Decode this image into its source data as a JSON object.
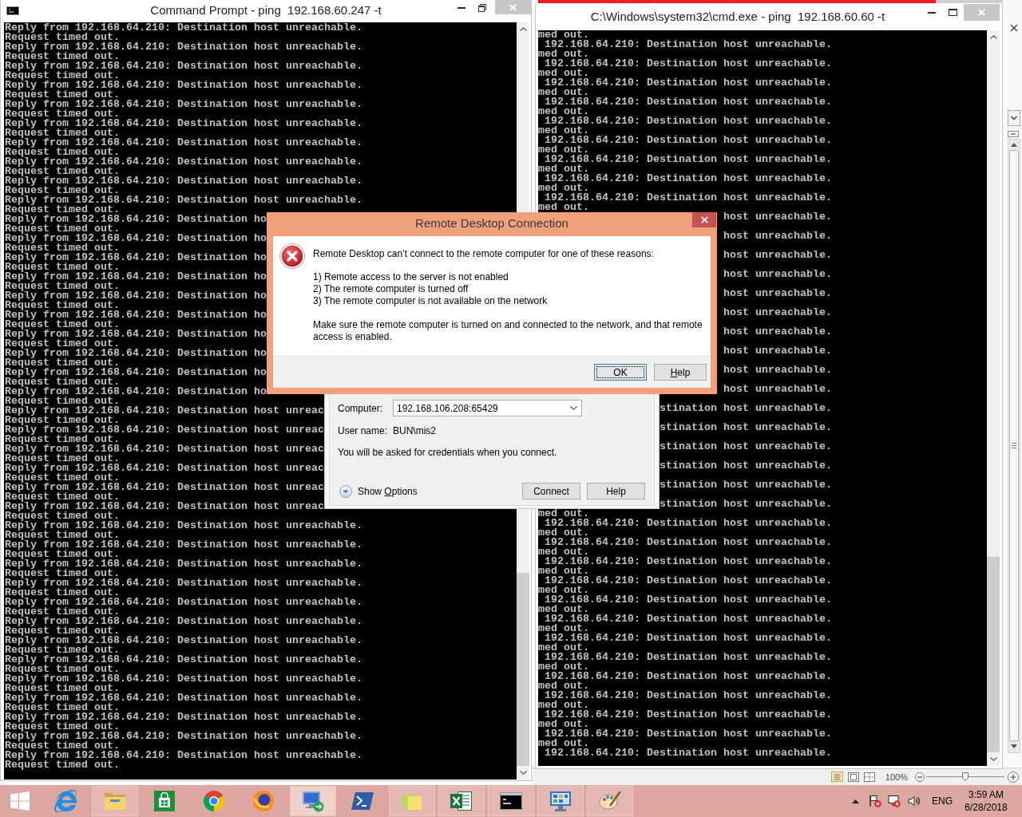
{
  "left_window": {
    "title": "Command Prompt - ping  192.168.60.247 -t",
    "lines": [
      "Reply from 192.168.64.210: Destination host unreachable.",
      "Request timed out.",
      "Reply from 192.168.64.210: Destination host unreachable.",
      "Request timed out.",
      "Reply from 192.168.64.210: Destination host unreachable.",
      "Request timed out.",
      "Reply from 192.168.64.210: Destination host unreachable.",
      "Request timed out.",
      "Reply from 192.168.64.210: Destination host unreachable.",
      "Request timed out.",
      "Reply from 192.168.64.210: Destination host unreachable.",
      "Request timed out.",
      "Reply from 192.168.64.210: Destination host unreachable.",
      "Request timed out.",
      "Reply from 192.168.64.210: Destination host unreachable.",
      "Request timed out.",
      "Reply from 192.168.64.210: Destination host unreachable.",
      "Request timed out.",
      "Reply from 192.168.64.210: Destination host unreachable.",
      "Request timed out.",
      "Reply from 192.168.64.210: Destination ho",
      "Request timed out.",
      "Reply from 192.168.64.210: Destination ho",
      "Request timed out.",
      "Reply from 192.168.64.210: Destination ho",
      "Request timed out.",
      "Reply from 192.168.64.210: Destination ho",
      "Request timed out.",
      "Reply from 192.168.64.210: Destination ho",
      "Request timed out.",
      "Reply from 192.168.64.210: Destination ho",
      "Request timed out.",
      "Reply from 192.168.64.210: Destination ho",
      "Request timed out.",
      "Reply from 192.168.64.210: Destination ho",
      "Request timed out.",
      "Reply from 192.168.64.210: Destination ho",
      "Request timed out.",
      "Reply from 192.168.64.210: Destination ho",
      "Request timed out.",
      "Reply from 192.168.64.210: Destination host unreac",
      "Request timed out.",
      "Reply from 192.168.64.210: Destination host unreac",
      "Request timed out.",
      "Reply from 192.168.64.210: Destination host unreac",
      "Request timed out.",
      "Reply from 192.168.64.210: Destination host unreac",
      "Request timed out.",
      "Reply from 192.168.64.210: Destination host unreac",
      "Request timed out.",
      "Reply from 192.168.64.210: Destination host unreac",
      "Request timed out.",
      "Reply from 192.168.64.210: Destination host unreachable.",
      "Request timed out.",
      "Reply from 192.168.64.210: Destination host unreachable.",
      "Request timed out.",
      "Reply from 192.168.64.210: Destination host unreachable.",
      "Request timed out.",
      "Reply from 192.168.64.210: Destination host unreachable.",
      "Request timed out.",
      "Reply from 192.168.64.210: Destination host unreachable.",
      "Request timed out.",
      "Reply from 192.168.64.210: Destination host unreachable.",
      "Request timed out.",
      "Reply from 192.168.64.210: Destination host unreachable.",
      "Request timed out.",
      "Reply from 192.168.64.210: Destination host unreachable.",
      "Request timed out.",
      "Reply from 192.168.64.210: Destination host unreachable.",
      "Request timed out.",
      "Reply from 192.168.64.210: Destination host unreachable.",
      "Request timed out.",
      "Reply from 192.168.64.210: Destination host unreachable.",
      "Request timed out.",
      "Reply from 192.168.64.210: Destination host unreachable.",
      "Request timed out.",
      "Reply from 192.168.64.210: Destination host unreachable.",
      "Request timed out."
    ]
  },
  "right_window": {
    "title": "C:\\Windows\\system32\\cmd.exe - ping  192.168.60.60 -t",
    "lines": [
      {
        "text": "med out.",
        "kind": "line"
      },
      {
        "text": " 192.168.64.210: Destination host unreachable.",
        "kind": "line"
      },
      {
        "text": "med out.",
        "kind": "line"
      },
      {
        "text": " 192.168.64.210: Destination host unreachable.",
        "kind": "line"
      },
      {
        "text": "med out.",
        "kind": "line"
      },
      {
        "text": " 192.168.64.210: Destination host unreachable.",
        "kind": "line"
      },
      {
        "text": "med out.",
        "kind": "line"
      },
      {
        "text": " 192.168.64.210: Destination host unreachable.",
        "kind": "line"
      },
      {
        "text": "med out.",
        "kind": "line"
      },
      {
        "text": " 192.168.64.210: Destination host unreachable.",
        "kind": "line"
      },
      {
        "text": "med out.",
        "kind": "line"
      },
      {
        "text": " 192.168.64.210: Destination host unreachable.",
        "kind": "line"
      },
      {
        "text": "med out.",
        "kind": "line"
      },
      {
        "text": " 192.168.64.210: Destination host unreachable.",
        "kind": "line"
      },
      {
        "text": "med out.",
        "kind": "line"
      },
      {
        "text": " 192.168.64.210: Destination host unreachable.",
        "kind": "line"
      },
      {
        "text": "med out.",
        "kind": "line"
      },
      {
        "text": " 192.168.64.210: Destination host unreachable.",
        "kind": "line"
      },
      {
        "text": "med out.",
        "kind": "line"
      },
      {
        "text": "host unreachable.",
        "kind": "tail"
      },
      {
        "kind": "covered"
      },
      {
        "text": "host unreachable.",
        "kind": "tail"
      },
      {
        "kind": "covered"
      },
      {
        "text": "host unreachable.",
        "kind": "tail"
      },
      {
        "kind": "covered"
      },
      {
        "text": "host unreachable.",
        "kind": "tail"
      },
      {
        "kind": "covered"
      },
      {
        "text": "host unreachable.",
        "kind": "tail"
      },
      {
        "kind": "covered"
      },
      {
        "text": "host unreachable.",
        "kind": "tail"
      },
      {
        "kind": "covered"
      },
      {
        "text": "host unreachable.",
        "kind": "tail"
      },
      {
        "kind": "covered"
      },
      {
        "text": "host unreachable.",
        "kind": "tail"
      },
      {
        "kind": "covered"
      },
      {
        "text": "host unreachable.",
        "kind": "tail"
      },
      {
        "kind": "covered"
      },
      {
        "text": "host unreachable.",
        "kind": "tail"
      },
      {
        "kind": "covered"
      },
      {
        "text": "stination host unreachable.",
        "kind": "tail"
      },
      {
        "kind": "covered"
      },
      {
        "text": "stination host unreachable.",
        "kind": "tail"
      },
      {
        "kind": "covered"
      },
      {
        "text": "stination host unreachable.",
        "kind": "tail"
      },
      {
        "kind": "covered"
      },
      {
        "text": "stination host unreachable.",
        "kind": "tail"
      },
      {
        "kind": "covered"
      },
      {
        "text": "stination host unreachable.",
        "kind": "tail"
      },
      {
        "kind": "covered"
      },
      {
        "text": "stination host unreachable.",
        "kind": "tail"
      },
      {
        "text": "med out.",
        "kind": "line"
      },
      {
        "text": " 192.168.64.210: Destination host unreachable.",
        "kind": "line"
      },
      {
        "text": "med out.",
        "kind": "line"
      },
      {
        "text": " 192.168.64.210: Destination host unreachable.",
        "kind": "line"
      },
      {
        "text": "med out.",
        "kind": "line"
      },
      {
        "text": " 192.168.64.210: Destination host unreachable.",
        "kind": "line"
      },
      {
        "text": "med out.",
        "kind": "line"
      },
      {
        "text": " 192.168.64.210: Destination host unreachable.",
        "kind": "line"
      },
      {
        "text": "med out.",
        "kind": "line"
      },
      {
        "text": " 192.168.64.210: Destination host unreachable.",
        "kind": "line"
      },
      {
        "text": "med out.",
        "kind": "line"
      },
      {
        "text": " 192.168.64.210: Destination host unreachable.",
        "kind": "line"
      },
      {
        "text": "med out.",
        "kind": "line"
      },
      {
        "text": " 192.168.64.210: Destination host unreachable.",
        "kind": "line"
      },
      {
        "text": "med out.",
        "kind": "line"
      },
      {
        "text": " 192.168.64.210: Destination host unreachable.",
        "kind": "line"
      },
      {
        "text": "med out.",
        "kind": "line"
      },
      {
        "text": " 192.168.64.210: Destination host unreachable.",
        "kind": "line"
      },
      {
        "text": "med out.",
        "kind": "line"
      },
      {
        "text": " 192.168.64.210: Destination host unreachable.",
        "kind": "line"
      },
      {
        "text": "med out.",
        "kind": "line"
      },
      {
        "text": " 192.168.64.210: Destination host unreachable.",
        "kind": "line"
      },
      {
        "text": "med out.",
        "kind": "line"
      },
      {
        "text": " 192.168.64.210: Destination host unreachable.",
        "kind": "line"
      },
      {
        "text": "med out.",
        "kind": "line"
      },
      {
        "text": " 192.168.64.210: Destination host unreachable.",
        "kind": "line"
      }
    ]
  },
  "error_dialog": {
    "title": "Remote Desktop Connection",
    "message": "Remote Desktop can’t connect to the remote computer for one of these reasons:",
    "reasons": [
      "1) Remote access to the server is not enabled",
      "2) The remote computer is turned off",
      "3) The remote computer is not available on the network"
    ],
    "advice": "Make sure the remote computer is turned on and connected to the network, and that remote access is enabled.",
    "buttons": [
      {
        "label_parts": [
          {
            "text": "OK",
            "underlined": false
          }
        ],
        "selected": true
      },
      {
        "label_parts": [
          {
            "text": "H",
            "underlined": true
          },
          {
            "text": "elp",
            "underlined": false
          }
        ],
        "selected": false
      }
    ]
  },
  "connection_window": {
    "fields": [
      {
        "label": "Computer:",
        "value": "192.168.106.208:65429",
        "kind": "combobox"
      },
      {
        "label": "User name:",
        "value": "BUN\\mis2",
        "kind": "text"
      }
    ],
    "note": "You will be asked for credentials when you connect.",
    "show_options": {
      "label_parts": [
        {
          "text": "Show ",
          "underlined": false
        },
        {
          "text": "O",
          "underlined": true
        },
        {
          "text": "ptions",
          "underlined": false
        }
      ]
    },
    "buttons": [
      "Connect",
      "Help"
    ]
  },
  "background_app": {
    "zoom_text": "100%",
    "zoom_slider": {
      "level": 0.5
    }
  },
  "taskbar": {
    "apps": [
      {
        "kind": "internet-explorer",
        "running": false,
        "selected": false
      },
      {
        "kind": "file-explorer",
        "running": true,
        "selected": false
      },
      {
        "kind": "store",
        "running": false,
        "selected": false
      },
      {
        "kind": "chrome",
        "running": false,
        "selected": false
      },
      {
        "kind": "firefox",
        "running": false,
        "selected": false
      },
      {
        "kind": "remote-desktop",
        "running": true,
        "selected": true
      },
      {
        "kind": "powershell",
        "running": false,
        "selected": false
      },
      {
        "kind": "sticky-notes",
        "running": true,
        "selected": false
      },
      {
        "kind": "excel",
        "running": true,
        "selected": false
      },
      {
        "kind": "command-prompt",
        "running": true,
        "selected": false
      },
      {
        "kind": "network-monitor",
        "running": true,
        "selected": false
      },
      {
        "kind": "paint",
        "running": true,
        "selected": false
      }
    ],
    "language": "ENG",
    "time": "3:59 AM",
    "date": "6/28/2018"
  }
}
